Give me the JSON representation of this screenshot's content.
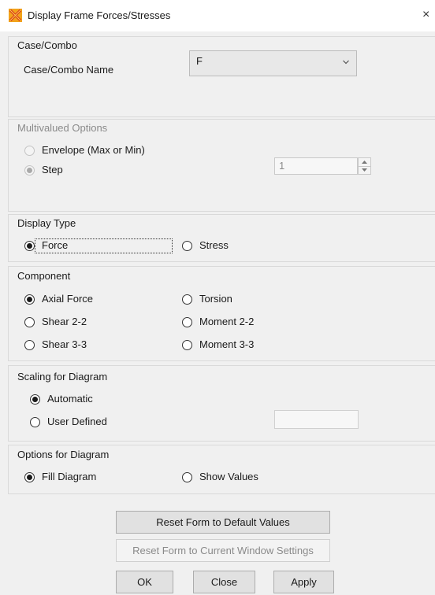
{
  "window": {
    "title": "Display Frame Forces/Stresses",
    "icon": "x-frame-app-icon",
    "close": "×"
  },
  "case_combo": {
    "title": "Case/Combo",
    "name_label": "Case/Combo Name",
    "selected": "F"
  },
  "multivalued": {
    "title": "Multivalued Options",
    "envelope_label": "Envelope (Max or Min)",
    "step_label": "Step",
    "step_value": "1",
    "selected": "step",
    "enabled": false
  },
  "display_type": {
    "title": "Display Type",
    "force_label": "Force",
    "stress_label": "Stress",
    "selected": "force"
  },
  "component": {
    "title": "Component",
    "axial_force": "Axial Force",
    "torsion": "Torsion",
    "shear_22": "Shear 2-2",
    "moment_22": "Moment 2-2",
    "shear_33": "Shear 3-3",
    "moment_33": "Moment 3-3",
    "selected": "axial_force"
  },
  "scaling": {
    "title": "Scaling for Diagram",
    "automatic": "Automatic",
    "user_defined": "User Defined",
    "selected": "automatic",
    "user_value": ""
  },
  "options": {
    "title": "Options for Diagram",
    "fill_diagram": "Fill Diagram",
    "show_values": "Show Values",
    "selected": "fill_diagram"
  },
  "buttons": {
    "reset_default": "Reset Form to Default Values",
    "reset_current": "Reset Form to Current Window Settings",
    "ok": "OK",
    "close": "Close",
    "apply": "Apply"
  },
  "colors": {
    "window_bg": "#f0f0f0",
    "titlebar_bg": "#ffffff",
    "disabled_text": "#8a8a8a",
    "button_bg": "#e1e1e1"
  }
}
